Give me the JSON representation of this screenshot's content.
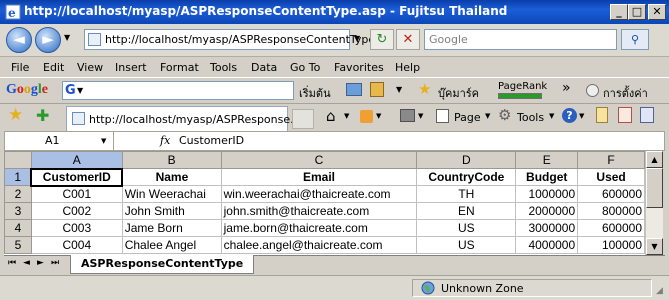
{
  "window": {
    "title": "http://localhost/myasp/ASPResponseContentType.asp - Fujitsu Thailand",
    "minimize": "_",
    "maximize": "□",
    "close": "✕"
  },
  "address": {
    "url": "http://localhost/myasp/ASPResponseContentType",
    "back": "◄",
    "forward": "►",
    "dropdown": "▼",
    "refresh": "↻",
    "stop": "✕",
    "search_placeholder": "Google",
    "search_go": "⚲"
  },
  "menu": [
    "File",
    "Edit",
    "View",
    "Insert",
    "Format",
    "Tools",
    "Data",
    "Go To",
    "Favorites",
    "Help"
  ],
  "google_toolbar": {
    "logo": "Google",
    "logo_select": "G",
    "search_label": "เริ่มต้น",
    "bookmarks": "บุ๊คมาร์ค",
    "pagerank": "PageRank",
    "more": "»",
    "settings": "การตั้งค่า"
  },
  "tab": {
    "title": "http://localhost/myasp/ASPResponse..."
  },
  "commandbar": {
    "page": "Page",
    "tools": "Tools",
    "help": "?"
  },
  "formula": {
    "cell_ref": "A1",
    "fx": "fx",
    "value": "CustomerID"
  },
  "sheet": {
    "col_headers": [
      "A",
      "B",
      "C",
      "D",
      "E",
      "F"
    ],
    "row_headers": [
      "1",
      "2",
      "3",
      "4",
      "5"
    ],
    "header_row": [
      "CustomerID",
      "Name",
      "Email",
      "CountryCode",
      "Budget",
      "Used"
    ],
    "rows": [
      [
        "C001",
        "Win Weerachai",
        "win.weerachai@thaicreate.com",
        "TH",
        "1000000",
        "600000"
      ],
      [
        "C002",
        "John Smith",
        "john.smith@thaicreate.com",
        "EN",
        "2000000",
        "800000"
      ],
      [
        "C003",
        "Jame Born",
        "jame.born@thaicreate.com",
        "US",
        "3000000",
        "600000"
      ],
      [
        "C004",
        "Chalee Angel",
        "chalee.angel@thaicreate.com",
        "US",
        "4000000",
        "100000"
      ]
    ],
    "tab_name": "ASPResponseContentType",
    "nav": [
      "⏮",
      "◄",
      "►",
      "⏭"
    ]
  },
  "status": {
    "zone": "Unknown Zone"
  }
}
